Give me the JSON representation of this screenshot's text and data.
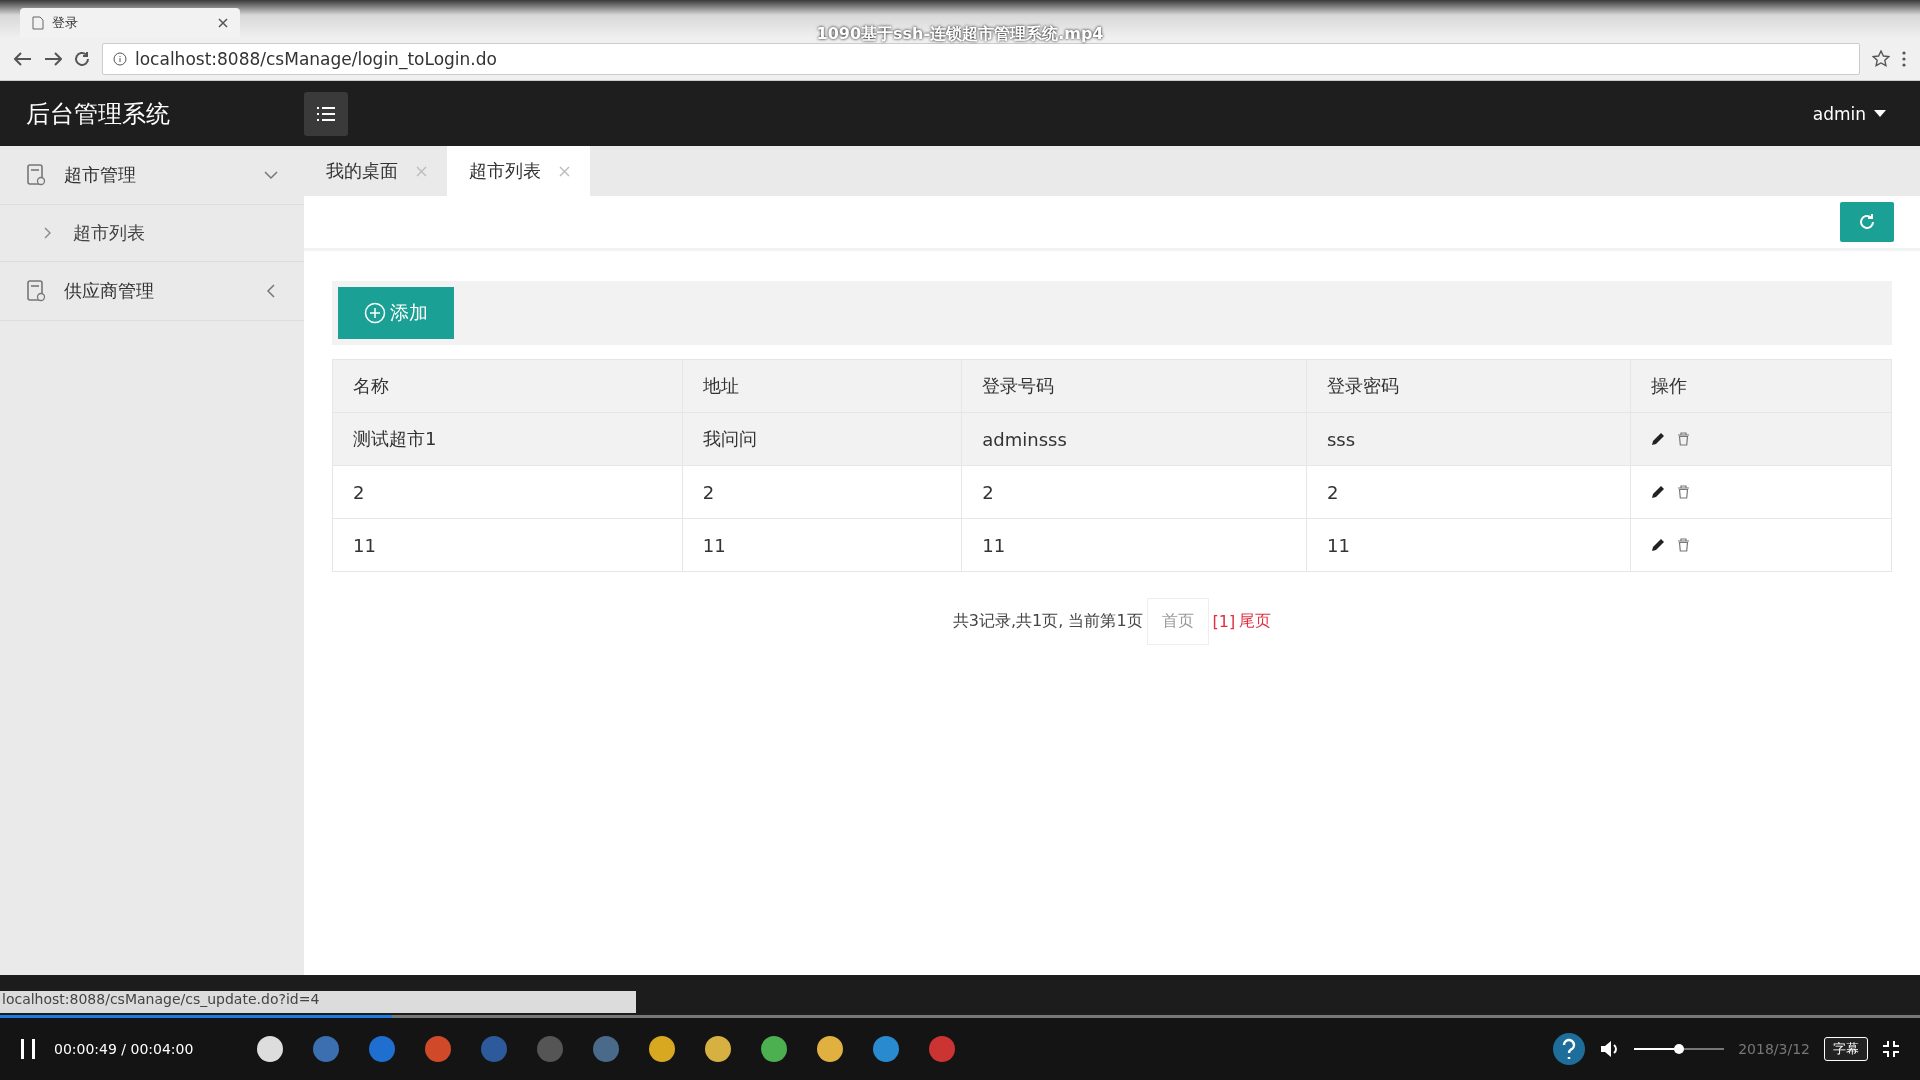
{
  "video": {
    "title": "1090基于ssh-连锁超市管理系统.mp4",
    "progress": {
      "level": 0.204
    },
    "time": "00:00:49 / 00:04:00",
    "volume": {
      "level": 0.5
    },
    "subtitle_button": "字幕"
  },
  "browser": {
    "tab_title": "登录",
    "url": "localhost:8088/csManage/login_toLogin.do",
    "status_url": "localhost:8088/csManage/cs_update.do?id=4"
  },
  "app": {
    "title": "后台管理系统",
    "user": "admin"
  },
  "sidebar": {
    "items": [
      {
        "label": "超市管理",
        "expanded": true,
        "children": [
          {
            "label": "超市列表"
          }
        ]
      },
      {
        "label": "供应商管理",
        "expanded": false
      }
    ]
  },
  "tabs": [
    {
      "label": "我的桌面",
      "selected": false
    },
    {
      "label": "超市列表",
      "selected": true
    }
  ],
  "toolbar": {
    "add_button": "添加"
  },
  "table": {
    "columns": [
      "名称",
      "地址",
      "登录号码",
      "登录密码",
      "操作"
    ],
    "rows": [
      {
        "cells": [
          "测试超市1",
          "我问问",
          "adminsss",
          "sss"
        ],
        "highlighted": true
      },
      {
        "cells": [
          "2",
          "2",
          "2",
          "2"
        ],
        "highlighted": false
      },
      {
        "cells": [
          "11",
          "11",
          "11",
          "11"
        ],
        "highlighted": false
      }
    ]
  },
  "pagination": {
    "summary": "共3记录,共1页, 当前第1页",
    "first": "首页",
    "pages": "[1]",
    "last": "尾页"
  },
  "taskbar": {
    "date": "2018/3/12"
  }
}
